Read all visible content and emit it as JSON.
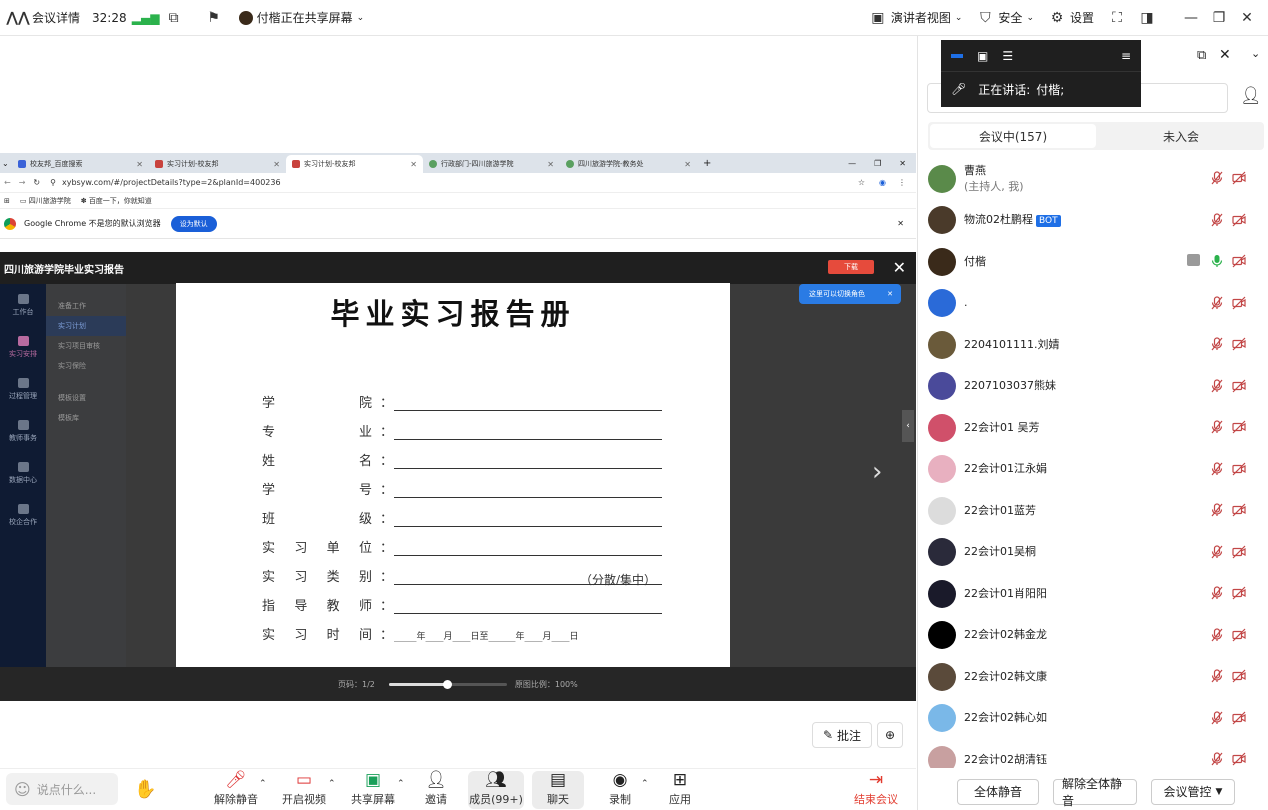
{
  "topbar": {
    "meeting_details": "会议详情",
    "timer": "32:28",
    "sharing_status": "付楷正在共享屏幕",
    "speaker_view": "演讲者视图",
    "security": "安全",
    "settings": "设置"
  },
  "browser": {
    "tabs": [
      {
        "label": "校友邦_百度搜索",
        "active": false
      },
      {
        "label": "实习计划-校友邦",
        "active": false
      },
      {
        "label": "实习计划-校友邦",
        "active": true
      },
      {
        "label": "行政部门-四川旅游学院",
        "active": false
      },
      {
        "label": "四川旅游学院-教务处",
        "active": false
      }
    ],
    "url": "xybsyw.com/#/projectDetails?type=2&planId=400236",
    "bookmarks": [
      "四川旅游学院",
      "百度一下，你就知道"
    ],
    "infobar_text": "Google Chrome 不是您的默认浏览器",
    "set_default": "设为默认"
  },
  "viewer": {
    "title": "四川旅游学院毕业实习报告",
    "download": "下载",
    "tip": "这里可以切换角色",
    "left_nav": [
      "工作台",
      "实习安排",
      "过程管理",
      "教师事务",
      "数据中心",
      "校企合作"
    ],
    "sub_nav": [
      "准备工作",
      "实习计划",
      "实习项目审核",
      "实习保险",
      "模板设置",
      "模板库"
    ],
    "page_info": "页码：1/2",
    "zoom_info": "原图比例：100%"
  },
  "document": {
    "title": "毕业实习报告册",
    "fields": [
      {
        "label": [
          "学",
          "院"
        ],
        "value": ""
      },
      {
        "label": [
          "专",
          "业"
        ],
        "value": ""
      },
      {
        "label": [
          "姓",
          "名"
        ],
        "value": ""
      },
      {
        "label": [
          "学",
          "号"
        ],
        "value": ""
      },
      {
        "label": [
          "班",
          "级"
        ],
        "value": ""
      },
      {
        "label": [
          "实",
          "习",
          "单",
          "位"
        ],
        "value": ""
      },
      {
        "label": [
          "实",
          "习",
          "类",
          "别"
        ],
        "value": "（分散/集中）"
      },
      {
        "label": [
          "指",
          "导",
          "教",
          "师"
        ],
        "value": ""
      },
      {
        "label": [
          "实",
          "习",
          "时",
          "间"
        ],
        "value": "_____年____月____日至______年____月____日"
      }
    ]
  },
  "annotate_label": "批注",
  "toolbar": {
    "chat_placeholder": "说点什么...",
    "unmute": "解除静音",
    "start_video": "开启视频",
    "share_screen": "共享屏幕",
    "invite": "邀请",
    "members": "成员(99+)",
    "chat": "聊天",
    "record": "录制",
    "apps": "应用",
    "end_meeting": "结束会议"
  },
  "panel": {
    "speaking_label": "正在讲话:",
    "speaking_name": "付楷;",
    "tab_in_meeting": "会议中(157)",
    "tab_not_joined": "未入会",
    "members": [
      {
        "name": "曹燕",
        "sub": "(主持人, 我)",
        "color": "#5a8a4a"
      },
      {
        "name": "物流02杜鹏程",
        "badge": "BOT",
        "color": "#4a3a2a"
      },
      {
        "name": "付楷",
        "color": "#3a2a1a",
        "sharing": true
      },
      {
        "name": ".",
        "color": "#2a6ad8"
      },
      {
        "name": "2204101111.刘婧",
        "color": "#6a5a3a"
      },
      {
        "name": "2207103037熊妹",
        "color": "#4a4a9a"
      },
      {
        "name": "22会计01 吴芳",
        "color": "#d0506a"
      },
      {
        "name": "22会计01江永娟",
        "color": "#e8b0c0"
      },
      {
        "name": "22会计01蓝芳",
        "color": "#dcdcdc"
      },
      {
        "name": "22会计01吴桐",
        "color": "#2a2a3a"
      },
      {
        "name": "22会计01肖阳阳",
        "color": "#1a1a2a"
      },
      {
        "name": "22会计02韩金龙",
        "color": "#000000"
      },
      {
        "name": "22会计02韩文康",
        "color": "#5a4a3a"
      },
      {
        "name": "22会计02韩心如",
        "color": "#7ab8e8"
      },
      {
        "name": "22会计02胡清钰",
        "color": "#c8a0a0"
      }
    ],
    "mute_all": "全体静音",
    "unmute_all": "解除全体静音",
    "meeting_control": "会议管控"
  }
}
